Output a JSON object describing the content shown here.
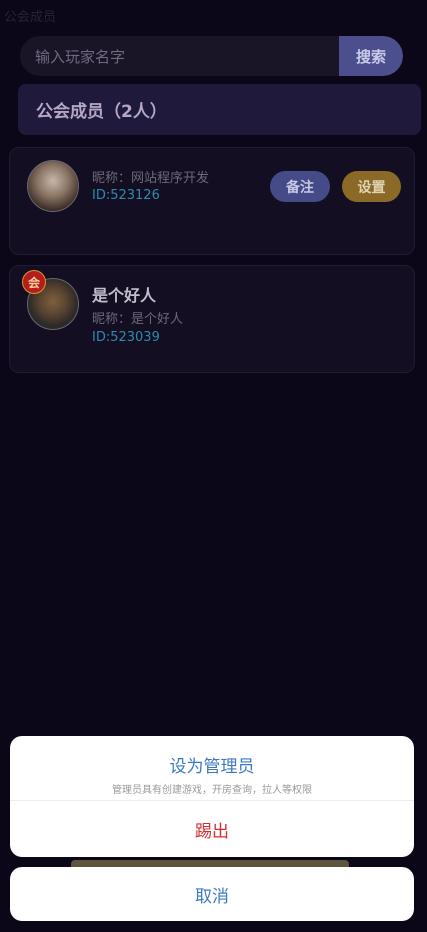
{
  "page": {
    "title": "公会成员"
  },
  "search": {
    "placeholder": "输入玩家名字",
    "button_label": "搜索"
  },
  "section": {
    "header": "公会成员（2人）"
  },
  "members": [
    {
      "nickname": "昵称：网站程序开发",
      "id": "ID:523126",
      "note_label": "备注",
      "settings_label": "设置"
    },
    {
      "name": "是个好人",
      "nickname": "昵称：是个好人",
      "id": "ID:523039",
      "badge": "会"
    }
  ],
  "action_sheet": {
    "set_admin": "设为管理员",
    "set_admin_desc": "管理员具有创建游戏，开房查询，拉人等权限",
    "kick": "踢出",
    "cancel": "取消"
  },
  "colors": {
    "background": "#0b0618",
    "accent_blue": "#3c79c0",
    "danger_red": "#d32f2f",
    "id_teal": "#2f8ab0",
    "note_button": "#454a88",
    "settings_button": "#8a6a26"
  }
}
